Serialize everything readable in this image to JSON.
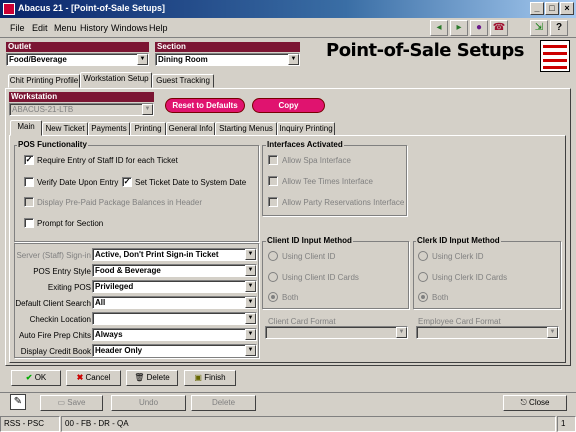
{
  "window": {
    "title": "Abacus 21 - [Point-of-Sale Setups]"
  },
  "menu": [
    "File",
    "Edit",
    "Menu",
    "History",
    "Windows",
    "Help"
  ],
  "toolbar_icons": [
    "arrow-left-icon",
    "arrow-right-icon",
    "person-icon",
    "phone-icon",
    "exit-icon",
    "help-icon"
  ],
  "outlet": {
    "label": "Outlet",
    "value": "Food/Beverage"
  },
  "section": {
    "label": "Section",
    "value": "Dining Room"
  },
  "page_title": "Point-of-Sale Setups",
  "outer_tabs": [
    "Chit Printing Profile",
    "Workstation Setup",
    "Guest Tracking"
  ],
  "workstation": {
    "label": "Workstation",
    "value": "ABACUS-21-LTB"
  },
  "buttons": {
    "reset": "Reset to Defaults",
    "copy": "Copy"
  },
  "inner_tabs": [
    "Main",
    "New Ticket",
    "Payments",
    "Printing",
    "General Info",
    "Starting Menus",
    "Inquiry Printing"
  ],
  "pos": {
    "title": "POS Functionality",
    "checks": [
      {
        "label": "Require Entry of Staff ID for each Ticket",
        "checked": "✓"
      },
      {
        "label": "Verify Date Upon Entry",
        "checked": ""
      },
      {
        "label": "Set Ticket Date to System Date",
        "checked": "✓"
      },
      {
        "label": "Display Pre-Paid Package Balances in Header",
        "checked": ""
      },
      {
        "label": "Prompt for Section",
        "checked": ""
      }
    ]
  },
  "interfaces": {
    "title": "Interfaces Activated",
    "items": [
      "Allow Spa Interface",
      "Allow Tee Times Interface",
      "Allow Party Reservations Interface"
    ]
  },
  "fields": [
    {
      "label": "Server (Staff) Sign-in",
      "value": "Active, Don't Print Sign-in Ticket"
    },
    {
      "label": "POS Entry Style",
      "value": "Food & Beverage"
    },
    {
      "label": "Exiting POS",
      "value": "Privileged"
    },
    {
      "label": "Default Client Search",
      "value": "All"
    },
    {
      "label": "Checkin Location",
      "value": ""
    },
    {
      "label": "Auto Fire Prep Chits",
      "value": "Always"
    },
    {
      "label": "Display Credit Book",
      "value": "Header Only"
    }
  ],
  "client_id": {
    "title": "Client ID Input Method",
    "options": [
      "Using Client ID",
      "Using Client ID Cards",
      "Both"
    ],
    "card_format": "Client Card Format"
  },
  "clerk_id": {
    "title": "Clerk ID Input Method",
    "options": [
      "Using Clerk ID",
      "Using Clerk ID Cards",
      "Both"
    ],
    "card_format": "Employee Card Format"
  },
  "actions": {
    "ok": "OK",
    "cancel": "Cancel",
    "delete": "Delete",
    "finish": "Finish"
  },
  "bottom": {
    "save": "Save",
    "undo": "Undo",
    "delete": "Delete",
    "close": "Close"
  },
  "status": {
    "left": "RSS - PSC",
    "mid": "00 - FB - DR - QA",
    "right": "1"
  }
}
